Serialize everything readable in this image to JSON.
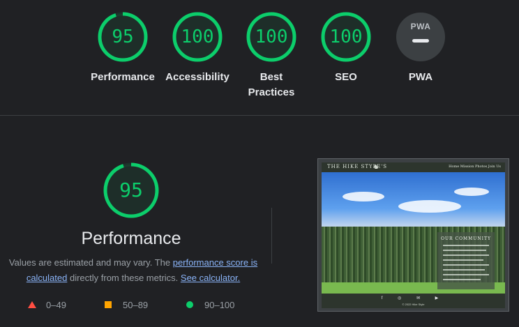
{
  "categories": [
    {
      "score": "95",
      "label": "Performance",
      "fraction": 0.95,
      "color": "#0cce6b"
    },
    {
      "score": "100",
      "label": "Accessibility",
      "fraction": 1.0,
      "color": "#0cce6b"
    },
    {
      "score": "100",
      "label": "Best Practices",
      "label_line1": "Best",
      "label_line2": "Practices",
      "fraction": 1.0,
      "color": "#0cce6b"
    },
    {
      "score": "100",
      "label": "SEO",
      "fraction": 1.0,
      "color": "#0cce6b"
    },
    {
      "score": "",
      "label": "PWA",
      "badge_text": "PWA"
    }
  ],
  "performance": {
    "score": "95",
    "fraction": 0.95,
    "title": "Performance",
    "desc_prefix": "Values are estimated and may vary. The ",
    "desc_link1": "performance score is calculated",
    "desc_middle": " directly from these metrics. ",
    "desc_link2": "See calculator."
  },
  "legend": [
    {
      "range": "0–49",
      "shape": "triangle",
      "color": "#ff4e42"
    },
    {
      "range": "50–89",
      "shape": "square",
      "color": "#ffa400"
    },
    {
      "range": "90–100",
      "shape": "circle",
      "color": "#0cce6b"
    }
  ],
  "thumbnail": {
    "brand": "THE HIKE STYLE'S",
    "nav_links": "Home   Mission   Photos   Join Us",
    "card_title": "OUR COMMUNITY",
    "footer_icons": "f ◎ ✉ ▶",
    "footer_copy": "© 2022 Hike Style"
  }
}
